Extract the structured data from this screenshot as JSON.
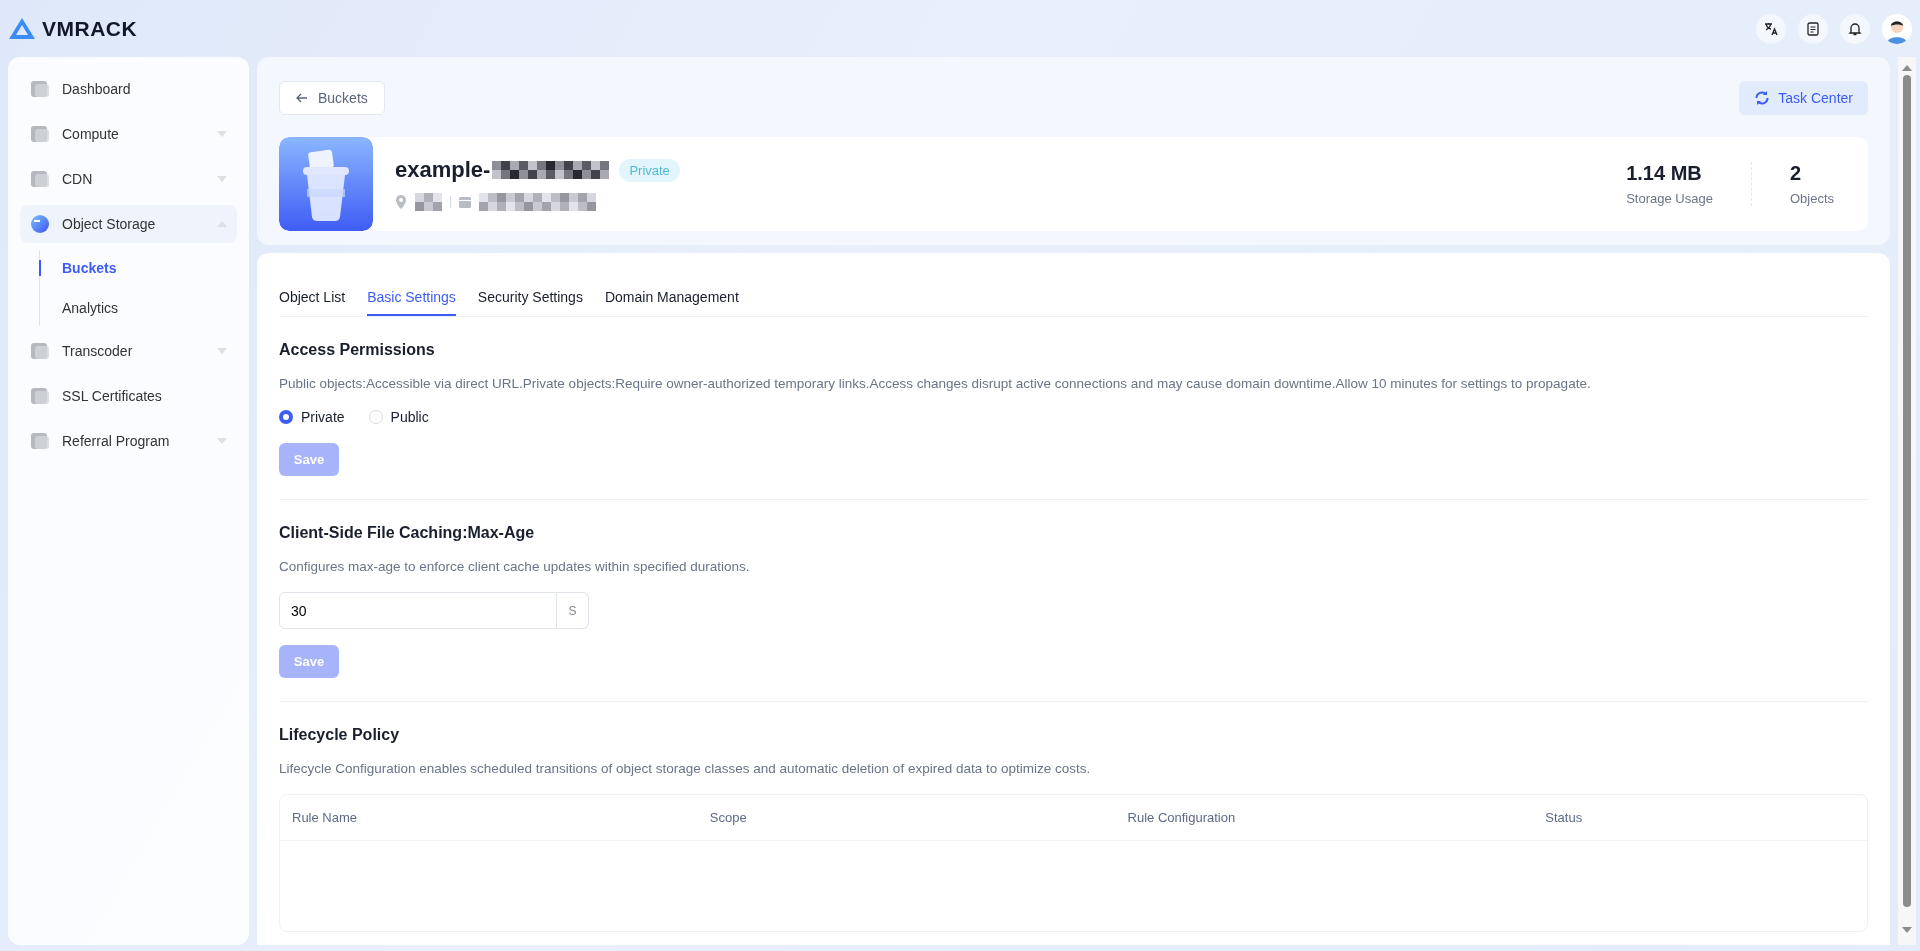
{
  "brand": {
    "name": "VMRACK"
  },
  "sidebar": {
    "items": [
      {
        "label": "Dashboard",
        "kind": "link",
        "selected": false
      },
      {
        "label": "Compute",
        "kind": "group",
        "expanded": false,
        "selected": false
      },
      {
        "label": "CDN",
        "kind": "group",
        "expanded": false,
        "selected": false
      },
      {
        "label": "Object Storage",
        "kind": "group",
        "expanded": true,
        "selected": true,
        "children": [
          {
            "label": "Buckets",
            "selected": true
          },
          {
            "label": "Analytics",
            "selected": false
          }
        ]
      },
      {
        "label": "Transcoder",
        "kind": "group",
        "expanded": false,
        "selected": false
      },
      {
        "label": "SSL Certificates",
        "kind": "link",
        "selected": false
      },
      {
        "label": "Referral Program",
        "kind": "group",
        "expanded": false,
        "selected": false
      }
    ]
  },
  "back_button": {
    "label": "Buckets"
  },
  "task_center": {
    "label": "Task Center"
  },
  "bucket": {
    "name": "example-",
    "access_badge": "Private",
    "stats": [
      {
        "value": "1.14 MB",
        "label": "Storage Usage"
      },
      {
        "value": "2",
        "label": "Objects"
      }
    ]
  },
  "tabs": [
    {
      "label": "Object List",
      "selected": false
    },
    {
      "label": "Basic Settings",
      "selected": true
    },
    {
      "label": "Security Settings",
      "selected": false
    },
    {
      "label": "Domain Management",
      "selected": false
    }
  ],
  "sections": [
    {
      "kind": "radio",
      "title": "Access Permissions",
      "description": "Public objects:Accessible via direct URL.Private objects:Require owner-authorized temporary links.Access changes disrupt active connections and may cause domain downtime.Allow 10 minutes for settings to propagate.",
      "options": [
        {
          "label": "Private",
          "selected": true
        },
        {
          "label": "Public",
          "selected": false
        }
      ],
      "save": {
        "label": "Save",
        "disabled": true
      }
    },
    {
      "kind": "input",
      "title": "Client-Side File Caching:Max-Age",
      "description": "Configures max-age to enforce client cache updates within specified durations.",
      "value": "30",
      "unit": "S",
      "save": {
        "label": "Save",
        "disabled": true
      }
    },
    {
      "kind": "table",
      "title": "Lifecycle Policy",
      "description": "Lifecycle Configuration enables scheduled transitions of object storage classes and automatic deletion of expired data to optimize costs.",
      "columns": [
        "Rule Name",
        "Scope",
        "Rule Configuration",
        "Status"
      ]
    }
  ]
}
